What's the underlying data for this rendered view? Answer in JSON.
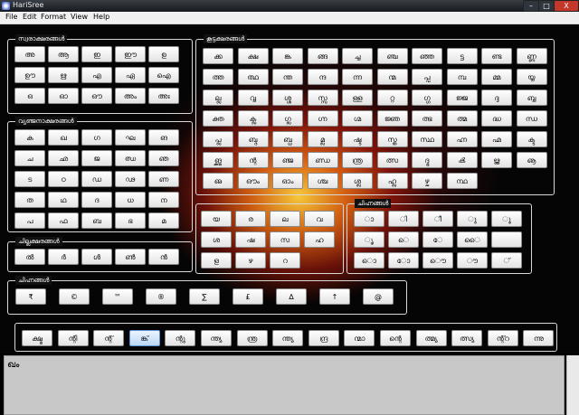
{
  "window": {
    "title": "HariSree",
    "minimize": "–",
    "maximize": "□",
    "close": "X"
  },
  "menu": [
    "File",
    "Edit",
    "Format",
    "View",
    "Help"
  ],
  "groups": {
    "swara": {
      "title": "സ്വരാക്ഷരങ്ങൾ",
      "rows": [
        [
          "അ",
          "ആ",
          "ഇ",
          "ഈ",
          "ഉ"
        ],
        [
          "ഊ",
          "ഋ",
          "എ",
          "ഏ",
          "ഐ"
        ],
        [
          "ഒ",
          "ഓ",
          "ഔ",
          "അം",
          "അഃ"
        ]
      ]
    },
    "vyanjana": {
      "title": "വ്യഞ്ജനാക്ഷരങ്ങൾ",
      "rows": [
        [
          "ക",
          "ഖ",
          "ഗ",
          "ഘ",
          "ങ"
        ],
        [
          "ച",
          "ഛ",
          "ജ",
          "ഝ",
          "ഞ"
        ],
        [
          "ട",
          "ഠ",
          "ഡ",
          "ഢ",
          "ണ"
        ],
        [
          "ത",
          "ഥ",
          "ദ",
          "ധ",
          "ന"
        ],
        [
          "പ",
          "ഫ",
          "ബ",
          "ഭ",
          "മ"
        ]
      ]
    },
    "chillu": {
      "title": "ചില്ലക്ഷരങ്ങൾ",
      "rows": [
        [
          "ൽ",
          "ർ",
          "ൾ",
          "ൺ",
          "ൻ"
        ]
      ]
    },
    "chihnam": {
      "title": "ചിഹ്നങ്ങൾ",
      "rows": [
        [
          "₹",
          "©",
          "™",
          "®",
          "∑",
          "£",
          "∆",
          "↑",
          "@"
        ]
      ]
    },
    "koottu": {
      "title": "കൂട്ടക്ഷരങ്ങൾ",
      "rows": [
        [
          "ക്ക",
          "ക്ഷ",
          "ങ്ക",
          "ങ്ങ",
          "ച്ച",
          "ഞ്ച",
          "ഞ്ഞ",
          "ട്ട",
          "ണ്ട",
          "ണ്ണ"
        ],
        [
          "ത്ത",
          "ത്ഥ",
          "ന്ത",
          "ന്ദ",
          "ന്ന",
          "ന്മ",
          "പ്പ",
          "മ്പ",
          "മ്മ",
          "യ്യ"
        ],
        [
          "ല്ല",
          "വ്വ",
          "ശ്ശ",
          "സ്സ",
          "ള്ള",
          "റ്റ",
          "ഗ്ഗ",
          "ജ്ജ",
          "ദ്ദ",
          "ബ്ബ"
        ],
        [
          "ക്ത",
          "ക്ല",
          "ഗ്ല",
          "ഗ്ന",
          "ഗ്മ",
          "ജ്ഞ",
          "ത്ഭ",
          "ത്മ",
          "ദ്ധ",
          "ന്ധ"
        ],
        [
          "പ്ല",
          "ബ്ദ",
          "ബ്ധ",
          "മ്ല",
          "ഷ്ട",
          "സ്ത",
          "സ്ഥ",
          "ഹ്ന",
          "ഹ്മ",
          "ക്ട"
        ],
        [
          "ങ്ക്ത",
          "ന്റ",
          "ഞ്ജ",
          "ണ്ഡ",
          "ന്ത്ര",
          "ത്സ",
          "ദ്ഭ",
          "ൿ",
          "ൠ",
          "ൡ"
        ],
        [
          "ഌ",
          "ഔം",
          "ഓം",
          "ശ്ച",
          "ശ്ല",
          "ഹ്ല",
          "ഴ്ച",
          "ന്ഥ"
        ]
      ]
    },
    "middle": {
      "title": "",
      "rows": [
        [
          "യ",
          "ര",
          "ല",
          "വ"
        ],
        [
          "ശ",
          "ഷ",
          "സ",
          "ഹ"
        ],
        [
          "ള",
          "ഴ",
          "റ"
        ]
      ]
    },
    "chinna": {
      "title": "ചിഹ്നങ്ങൾ",
      "rows": [
        [
          "ാ",
          "ി",
          "ീ",
          "ു",
          "ൂ"
        ],
        [
          "ൃ",
          "െ",
          "േ",
          "ൈ",
          ""
        ],
        [
          "ൊ",
          "ോ",
          "ൌ",
          "ൗ",
          "്"
        ]
      ]
    },
    "bottom": {
      "row": [
        "ക്ഷ്മ",
        "ന്റി",
        "ന്റ്",
        "ങ്ക്",
        "ന്റു",
        "ന്ത്യ",
        "ന്ത്ര",
        "ന്ത്യ",
        "ന്ദ്ര",
        "ന്മാ",
        "ന്റെ",
        "ത്മ്യ",
        "ത്സ്യ",
        "ന്റ്റ",
        "ന്നു"
      ],
      "highlight_index": 3
    }
  },
  "textarea": {
    "value": "ഖം"
  },
  "colors": {
    "canvas": "#050505",
    "glow": "#ff7a14",
    "key_face": "#f2f2f2",
    "group_border": "#d8d8d8"
  }
}
